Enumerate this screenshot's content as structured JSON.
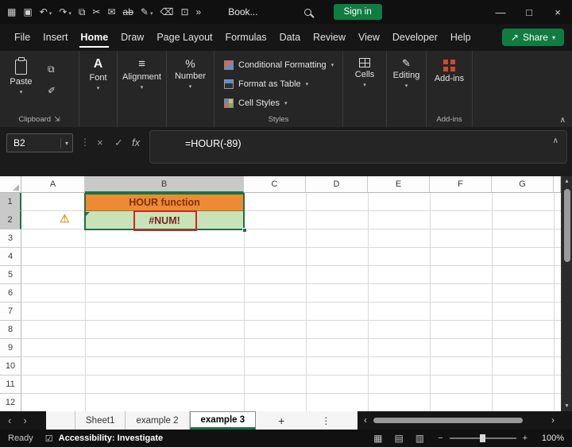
{
  "glyphs": {
    "dropdown": "▾",
    "chevron_up": "∧",
    "dots_vertical": "⋮",
    "scroll_left": "‹",
    "scroll_right": "›",
    "scroll_up": "▲",
    "scroll_down": "▼",
    "share": "↗",
    "add": "+",
    "dialog_launcher": "⇲",
    "warning": "⚠",
    "acc_check": "☑",
    "grid_view": "▦",
    "page_layout_view": "▤",
    "page_break_view": "▥"
  },
  "titlebar": {
    "workbook_name": "Book...",
    "sign_in_label": "Sign in",
    "qat": [
      {
        "name": "app-launcher",
        "glyph": "▦"
      },
      {
        "name": "save",
        "glyph": "▣"
      },
      {
        "name": "undo",
        "glyph": "↶"
      },
      {
        "name": "redo",
        "glyph": "↷"
      },
      {
        "name": "clipboard",
        "glyph": "⧉"
      },
      {
        "name": "cut",
        "glyph": "✂"
      },
      {
        "name": "mail",
        "glyph": "✉"
      },
      {
        "name": "strikethrough",
        "glyph": "ab"
      },
      {
        "name": "draw",
        "glyph": "✎"
      },
      {
        "name": "erase",
        "glyph": "⌫"
      },
      {
        "name": "camera",
        "glyph": "⊡"
      },
      {
        "name": "overflow",
        "glyph": "»"
      }
    ],
    "window": {
      "minimize": "—",
      "maximize": "□",
      "close": "×"
    }
  },
  "menubar": {
    "items": [
      "File",
      "Insert",
      "Home",
      "Draw",
      "Page Layout",
      "Formulas",
      "Data",
      "Review",
      "View",
      "Developer",
      "Help"
    ],
    "active": "Home",
    "share_label": "Share"
  },
  "ribbon": {
    "paste_label": "Paste",
    "clipboard_group_label": "Clipboard",
    "font": {
      "label": "Font",
      "icon_glyph": "A"
    },
    "alignment": {
      "label": "Alignment",
      "icon_glyph": "≡"
    },
    "number": {
      "label": "Number",
      "icon_glyph": "%"
    },
    "styles": {
      "conditional_formatting": "Conditional Formatting",
      "format_as_table": "Format as Table",
      "cell_styles": "Cell Styles",
      "group_label": "Styles"
    },
    "cells_label": "Cells",
    "editing": {
      "label": "Editing",
      "icon_glyph": "✎"
    },
    "addins_label": "Add-ins",
    "addins_group_label": "Add-ins",
    "copy_icon_glyph": "⧉",
    "format_painter_glyph": "✐"
  },
  "formula_bar": {
    "name_box": "B2",
    "cancel_glyph": "×",
    "enter_glyph": "✓",
    "fx_label": "fx",
    "formula": "=HOUR(-89)"
  },
  "grid": {
    "columns": [
      "A",
      "B",
      "C",
      "D",
      "E",
      "F",
      "G"
    ],
    "rows": [
      "1",
      "2",
      "3",
      "4",
      "5",
      "6",
      "7",
      "8",
      "9",
      "10",
      "11",
      "12"
    ],
    "cells": {
      "B1": {
        "text": "HOUR function",
        "fill": "#ED8B35",
        "text_color": "#7E2F08"
      },
      "B2": {
        "text": "#NUM!",
        "fill": "#C9E3B8",
        "annotation": "red outline box"
      }
    },
    "selection": {
      "active_cell": "B2",
      "range": "B1:B2"
    }
  },
  "sheet_tabs": {
    "tabs": [
      "Sheet1",
      "example 2",
      "example 3"
    ],
    "active": "example 3"
  },
  "status_bar": {
    "mode": "Ready",
    "accessibility": "Accessibility: Investigate",
    "zoom_out": "−",
    "zoom_in": "+",
    "zoom": "100%"
  },
  "colors": {
    "accent_green": "#107C41",
    "selection_green": "#1E7145",
    "cell_b1_fill": "#ED8B35",
    "cell_b2_fill": "#C9E3B8",
    "error_box_red": "#D02424",
    "addins_orange": "#D0492C"
  }
}
